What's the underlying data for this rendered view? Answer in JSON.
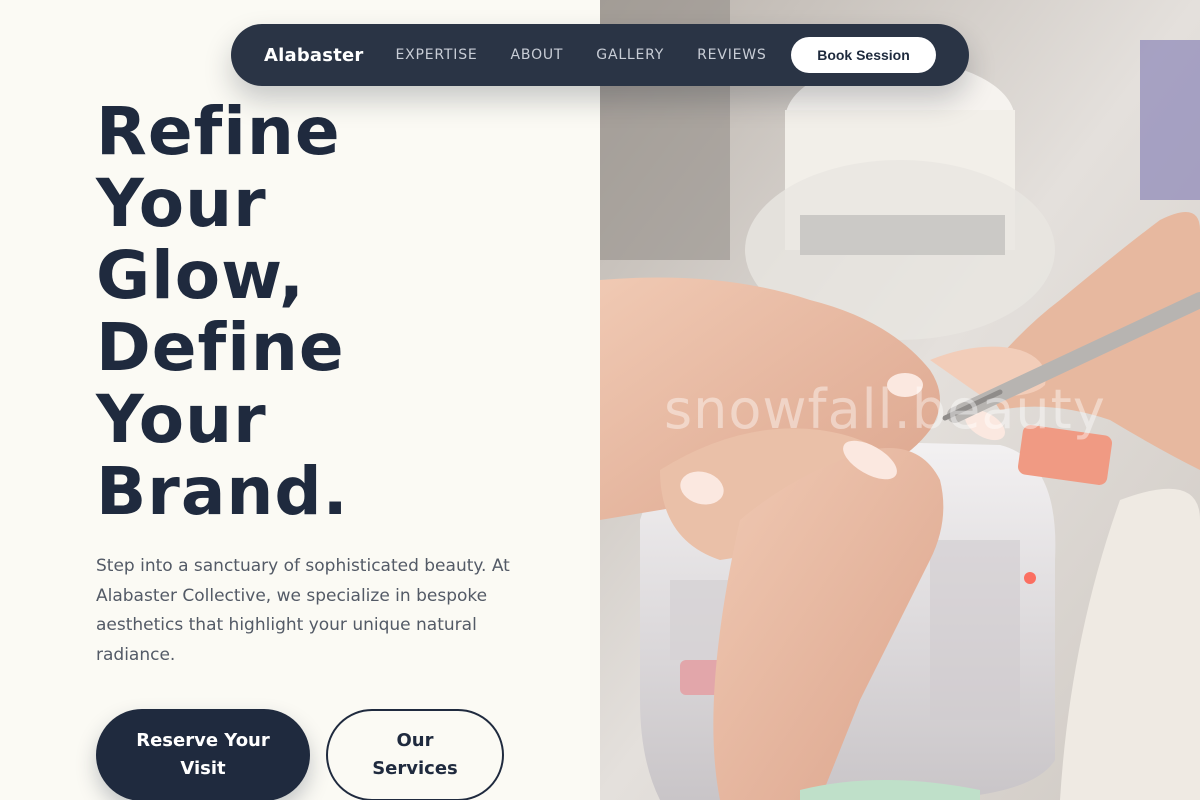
{
  "nav": {
    "brand": "Alabaster",
    "links": [
      "EXPERTISE",
      "ABOUT",
      "GALLERY",
      "REVIEWS"
    ],
    "cta": "Book Session"
  },
  "hero": {
    "title_lines": [
      "Refine",
      "Your",
      "Glow,",
      "Define",
      "Your",
      "Brand."
    ],
    "description": "Step into a sanctuary of sophisticated beauty. At Alabaster Collective, we specialize in bespoke aesthetics that highlight your unique natural radiance.",
    "primary_cta": "Reserve Your Visit",
    "secondary_cta": "Our Services"
  },
  "image": {
    "subject": "manicure-photo",
    "watermark": "snowfall.beauty"
  },
  "colors": {
    "navy": "#1f2a3e",
    "nav_bg": "#2a3445",
    "page_bg": "#fbfaf4",
    "body_text": "#535a66"
  }
}
